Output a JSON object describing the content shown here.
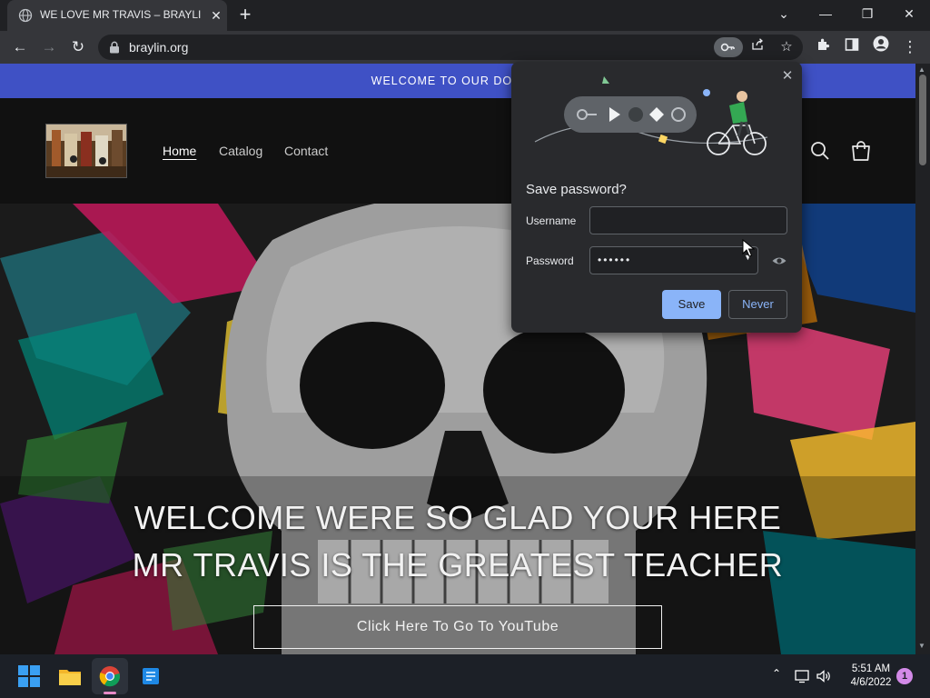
{
  "browser": {
    "tab_title": "WE LOVE MR TRAVIS – BRAYLIN.ORG",
    "tab_close": "✕",
    "new_tab": "+",
    "url": "braylin.org",
    "window_controls": {
      "dropdown": "⌄",
      "minimize": "—",
      "restore": "❐",
      "close": "✕"
    },
    "toolbar": {
      "back": "←",
      "forward": "→",
      "reload": "↻",
      "menu": "⋮"
    },
    "omnibox_icons": [
      "key-icon",
      "share-icon",
      "star-icon"
    ],
    "toolbar_icons": [
      "extensions-icon",
      "side-panel-icon",
      "profile-icon"
    ]
  },
  "site": {
    "announcement": "WELCOME TO OUR DOMAIN",
    "nav": [
      {
        "label": "Home",
        "active": true
      },
      {
        "label": "Catalog",
        "active": false
      },
      {
        "label": "Contact",
        "active": false
      }
    ],
    "hero_title": "WELCOME WERE SO GLAD YOUR HERE MR TRAVIS IS THE GREATEST TEACHER",
    "hero_button": "Click Here To Go To YouTube"
  },
  "password_bubble": {
    "title": "Save password?",
    "username_label": "Username",
    "username_value": "",
    "password_label": "Password",
    "password_value": "••••••",
    "save_label": "Save",
    "never_label": "Never",
    "close": "✕"
  },
  "taskbar": {
    "time": "5:51 AM",
    "date": "4/6/2022",
    "notification_count": "1",
    "pinned": [
      "windows-start-icon",
      "file-explorer-icon",
      "chrome-icon",
      "app-icon"
    ],
    "tray": [
      "chevron-up-icon",
      "network-icon",
      "volume-icon"
    ]
  },
  "colors": {
    "announcement_bar": "#3f51c5",
    "save_button": "#8ab4f8",
    "browser_frame": "#202124",
    "toolbar": "#35363a"
  }
}
